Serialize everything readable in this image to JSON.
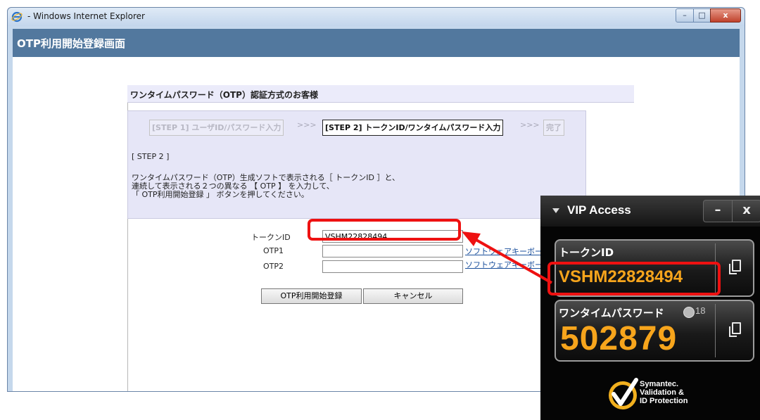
{
  "browser": {
    "title": "- Windows Internet Explorer",
    "controls": {
      "minimize": "–",
      "maximize": "□",
      "close": "x"
    }
  },
  "page": {
    "header": "OTP利用開始登録画面",
    "section_title": "ワンタイムパスワード（OTP）認証方式のお客様",
    "steps": [
      {
        "label": "[STEP 1] ユーザID/パスワード入力",
        "state": "inactive"
      },
      {
        "label": "[STEP 2] トークンID/ワンタイムパスワード入力",
        "state": "active"
      },
      {
        "label": "完了",
        "state": "inactive"
      }
    ],
    "step_separator": ">>>",
    "step_heading": "[ STEP 2 ]",
    "instructions": [
      "ワンタイムパスワード（OTP）生成ソフトで表示される［ トークンID ］と、",
      "連続して表示される２つの異なる 【 OTP 】 を入力して、",
      "「 OTP利用開始登録 」 ボタンを押してください。"
    ],
    "form": {
      "token_id_label": "トークンID",
      "token_id_value": "VSHM22828494",
      "otp1_label": "OTP1",
      "otp1_value": "",
      "otp2_label": "OTP2",
      "otp2_value": "",
      "software_keyboard_link_1": "ソフトウェアキーボード",
      "software_keyboard_link_2": "ソフトウェアキーボード"
    },
    "buttons": {
      "register": "OTP利用開始登録",
      "cancel": "キャンセル"
    }
  },
  "vip_access": {
    "title": "VIP Access",
    "minimize": "–",
    "close": "x",
    "token_id_label": "トークンID",
    "token_id": "VSHM22828494",
    "otp_label": "ワンタイムパスワード",
    "countdown": "18",
    "otp": "502879",
    "brand_line1": "Symantec.",
    "brand_line2": "Validation &",
    "brand_line3": "ID Protection"
  },
  "colors": {
    "header_bg": "#52789e",
    "vip_digits": "#f7a51c",
    "highlight": "#ee1111",
    "link": "#1a4f9c"
  }
}
